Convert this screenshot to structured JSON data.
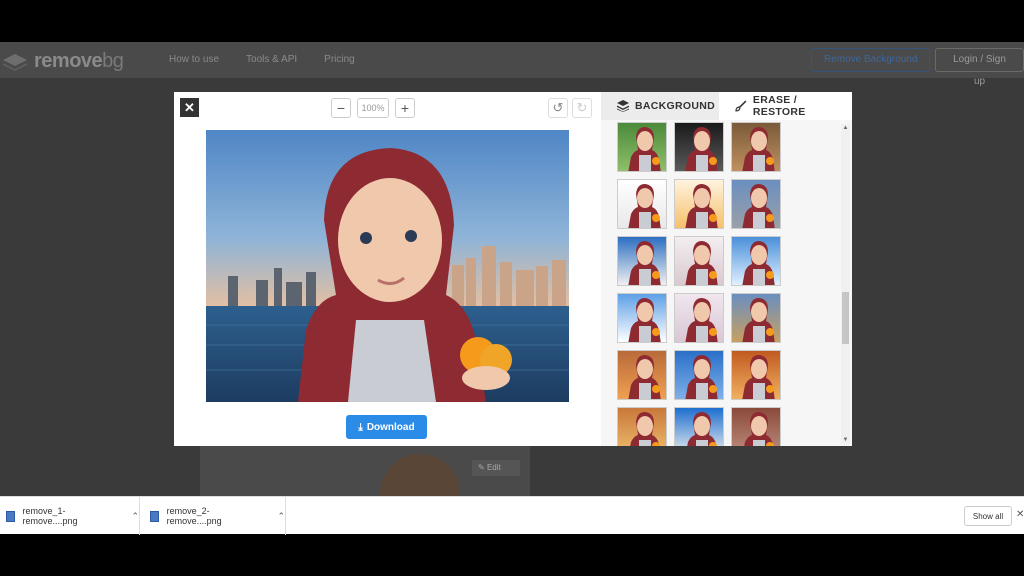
{
  "site_header": {
    "logo_text_a": "remove",
    "logo_text_b": "bg",
    "nav": [
      "How to use",
      "Tools & API",
      "Pricing"
    ],
    "remove_bg_button": "Remove Background",
    "login_button": "Login / Sign up"
  },
  "modal": {
    "close_glyph": "✕",
    "zoom_out": "−",
    "zoom_value": "100%",
    "zoom_in": "+",
    "undo_glyph": "↺",
    "redo_glyph": "↻",
    "download_label": "Download",
    "tabs": [
      {
        "label": "BACKGROUND",
        "icon": "layers-icon"
      },
      {
        "label": "ERASE / RESTORE",
        "icon": "brush-icon"
      }
    ]
  },
  "background_edit_label": "Edit",
  "downloads": [
    {
      "name": "remove_1-remove....png"
    },
    {
      "name": "remove_2-remove....png"
    }
  ],
  "show_all": "Show all",
  "colors": {
    "accent": "#2b8ce8",
    "modal_bg": "#ffffff",
    "overlay": "#3a3a3a"
  }
}
